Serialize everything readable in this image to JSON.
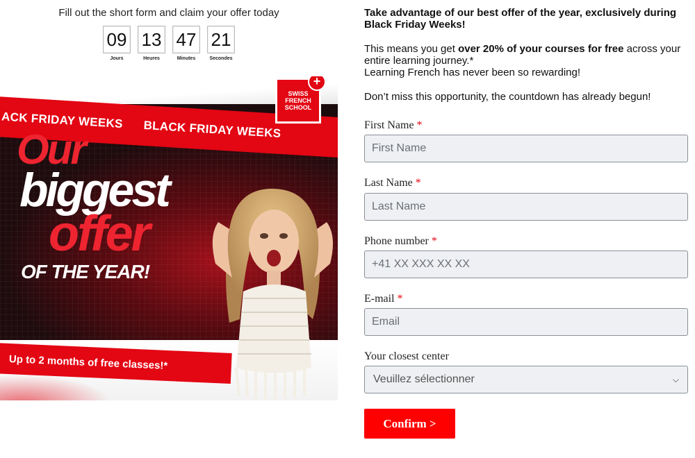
{
  "left": {
    "cta_text": "Fill out the short form and claim your offer today",
    "countdown": [
      {
        "value": "09",
        "label": "Jours"
      },
      {
        "value": "13",
        "label": "Heures"
      },
      {
        "value": "47",
        "label": "Minutes"
      },
      {
        "value": "21",
        "label": "Secondes"
      }
    ],
    "banner": {
      "strip_text_1": "ACK FRIDAY WEEKS",
      "strip_text_2": "BLACK FRIDAY WEEKS",
      "logo_text": "SWISS FRENCH SCHOOL",
      "headline_1": "Our",
      "headline_2": "biggest",
      "headline_3": "offer",
      "headline_4": "OF THE YEAR!",
      "bottom_text": "Up to 2 months of free classes!*"
    }
  },
  "right": {
    "promo_heading": "Take advantage of our best offer of the year, exclusively during Black Friday Weeks!",
    "promo_body_prefix": "This means you get ",
    "promo_body_bold": "over 20% of your courses for free",
    "promo_body_suffix": " across your entire learning journey.*",
    "promo_line2": "Learning French has never been so rewarding!",
    "promo_miss": "Don’t miss this opportunity, the countdown has already begun!",
    "form": {
      "first_name_label": "First Name",
      "first_name_placeholder": "First Name",
      "last_name_label": "Last Name",
      "last_name_placeholder": "Last Name",
      "phone_label": "Phone number",
      "phone_placeholder": "+41 XX XXX XX XX",
      "email_label": "E-mail",
      "email_placeholder": "Email",
      "center_label": "Your closest center",
      "center_selected": "Veuillez sélectionner",
      "required_marker": "*",
      "confirm_label": "Confirm >"
    }
  },
  "colors": {
    "brand_red": "#e30613",
    "button_red": "#ff0000",
    "input_bg": "#eef0f3"
  }
}
